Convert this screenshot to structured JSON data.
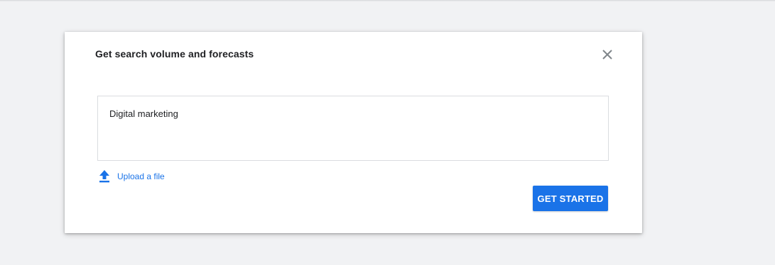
{
  "dialog": {
    "title": "Get search volume and forecasts",
    "close_icon": "close-icon",
    "keywords_value": "Digital marketing",
    "upload_icon": "upload-icon",
    "upload_label": "Upload a file",
    "cta_label": "GET STARTED"
  },
  "colors": {
    "accent": "#1a73e8",
    "background": "#f1f2f4",
    "dialog": "#ffffff",
    "text": "#202124",
    "close_icon": "#80868b"
  }
}
